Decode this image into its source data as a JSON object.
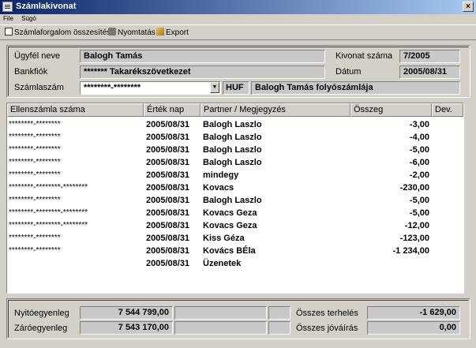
{
  "window": {
    "title": "Számlakivonat",
    "close_glyph": "×"
  },
  "menu": [
    "File",
    "Súgó"
  ],
  "toolbar": {
    "summary_label": "Számlaforgalom összesítése",
    "print_label": "Nyomtatás",
    "export_label": "Export"
  },
  "info": {
    "client_label": "Ügyfél neve",
    "client_value": "Balogh Tamás",
    "branch_label": "Bankfiók",
    "branch_value": "******* Takarékszövetkezet",
    "account_label": "Számlaszám",
    "account_value": "********-********",
    "currency": "HUF",
    "account_desc": "Balogh Tamás folyószámlája",
    "statement_label": "Kivonat száma",
    "statement_value": "7/2005",
    "date_label": "Dátum",
    "date_value": "2005/08/31"
  },
  "table": {
    "headers": [
      "Ellenszámla száma",
      "Érték nap",
      "Partner / Megjegyzés",
      "Összeg",
      "Dev."
    ],
    "rows": [
      [
        "********-********",
        "2005/08/31",
        "Balogh Laszlo",
        "-3,00"
      ],
      [
        "********-********",
        "2005/08/31",
        "Balogh Laszlo",
        "-4,00"
      ],
      [
        "********-********",
        "2005/08/31",
        "Balogh Laszlo",
        "-5,00"
      ],
      [
        "********-********",
        "2005/08/31",
        "Balogh Laszlo",
        "-6,00"
      ],
      [
        "********-********",
        "2005/08/31",
        "mindegy",
        "-2,00"
      ],
      [
        "********-********-********",
        "2005/08/31",
        "Kovacs",
        "-230,00"
      ],
      [
        "********-********",
        "2005/08/31",
        "Balogh Laszlo",
        "-5,00"
      ],
      [
        "********-********-********",
        "2005/08/31",
        "Kovacs Geza",
        "-5,00"
      ],
      [
        "********-********-********",
        "2005/08/31",
        "Kovacs Geza",
        "-12,00"
      ],
      [
        "********-********",
        "2005/08/31",
        "Kiss Géza",
        "-123,00"
      ],
      [
        "********-********",
        "2005/08/31",
        "Kovács BÉla",
        "-1 234,00"
      ],
      [
        "",
        "2005/08/31",
        "Üzenetek",
        ""
      ]
    ]
  },
  "footer": {
    "opening_label": "Nyitóegyenleg",
    "opening_value": "7 544 799,00",
    "closing_label": "Záróegyenleg",
    "closing_value": "7 543 170,00",
    "debit_label": "Összes terhelés",
    "debit_value": "-1 629,00",
    "credit_label": "Összes jóváírás",
    "credit_value": "0,00"
  }
}
